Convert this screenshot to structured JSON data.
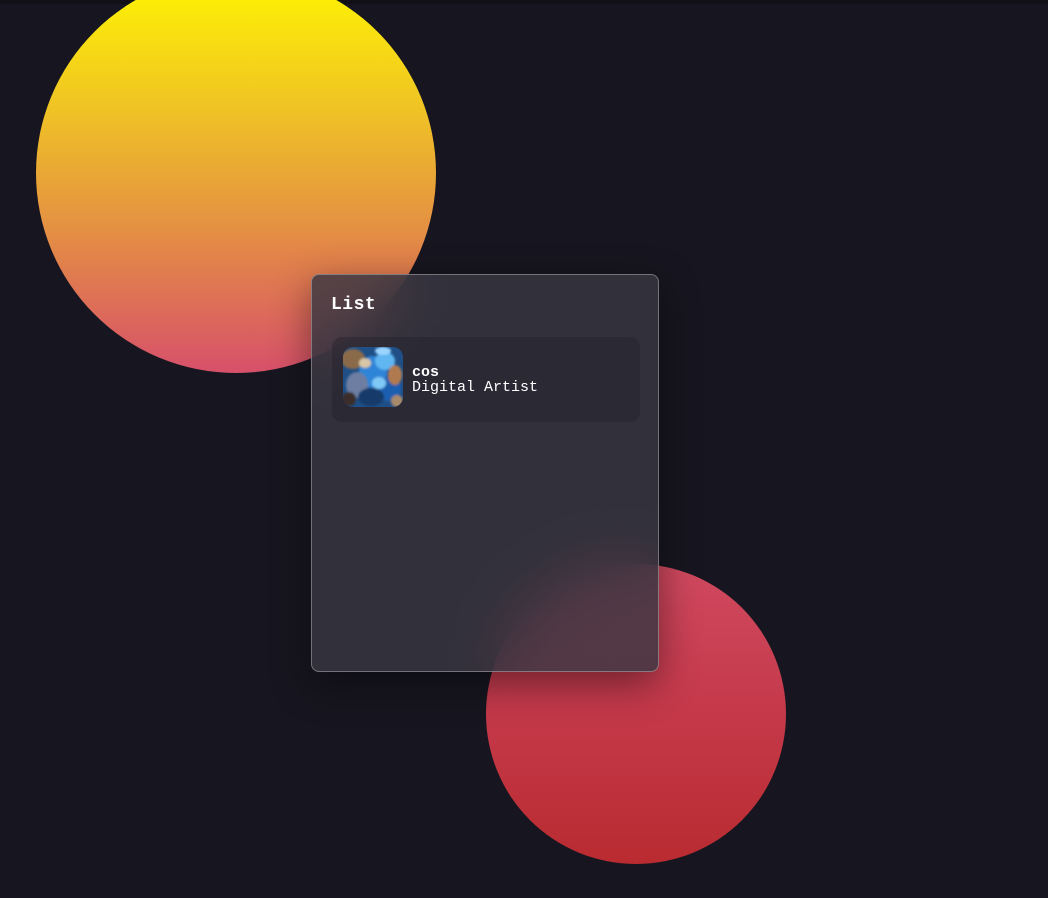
{
  "list_card": {
    "title": "List",
    "items": [
      {
        "name": "cos",
        "role": "Digital Artist",
        "avatar": "abstract-blue-artwork"
      }
    ]
  },
  "colors": {
    "background": "#171620",
    "yellow_circle_gradient": [
      "#fff700",
      "#efc126",
      "#e48e44",
      "#d7506a"
    ],
    "red_circle_gradient": [
      "#d0495f",
      "#c63a4c",
      "#b92b30"
    ],
    "text": "#ffffff"
  }
}
